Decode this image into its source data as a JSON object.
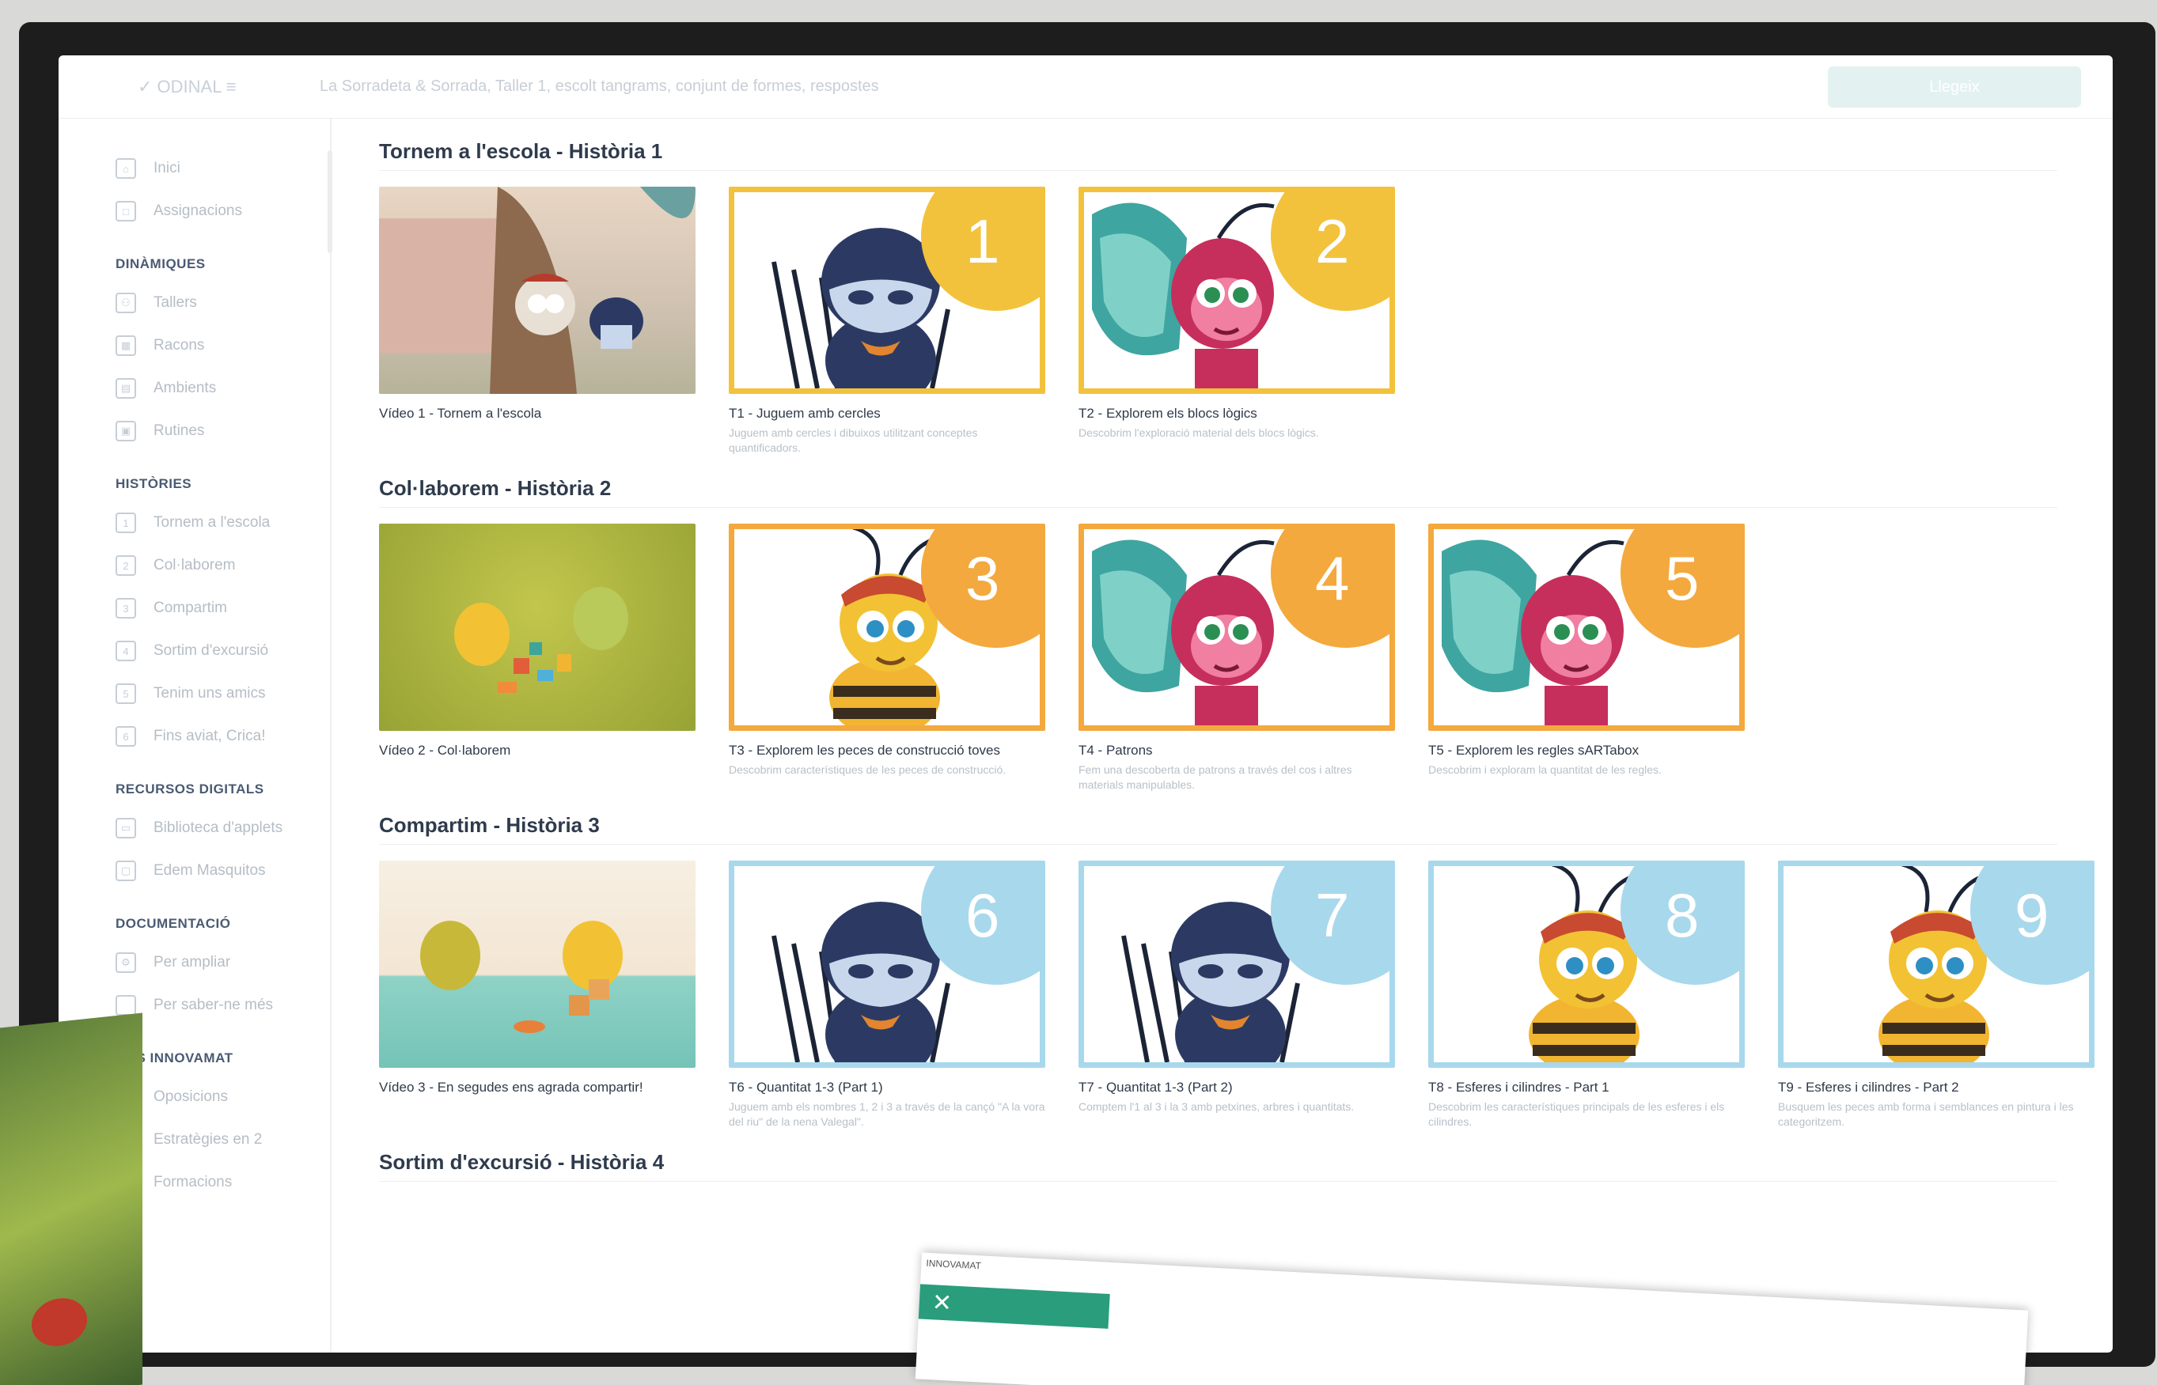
{
  "topbar": {
    "logo": "✓ ODINAL ≡",
    "title": "La Sorradeta & Sorrada, Taller 1, escolt tangrams, conjunt de formes, respostes",
    "button": "Llegeix"
  },
  "sidebar": {
    "top_items": [
      {
        "icon": "home-icon",
        "glyph": "⌂",
        "label": "Inici"
      },
      {
        "icon": "book-icon",
        "glyph": "□",
        "label": "Assignacions"
      }
    ],
    "sections": [
      {
        "title": "DINÀMIQUES",
        "items": [
          {
            "icon": "people-icon",
            "glyph": "⚇",
            "label": "Tallers"
          },
          {
            "icon": "grid-icon",
            "glyph": "▦",
            "label": "Racons"
          },
          {
            "icon": "layout-icon",
            "glyph": "▤",
            "label": "Ambients"
          },
          {
            "icon": "calendar-icon",
            "glyph": "▣",
            "label": "Rutines"
          }
        ]
      },
      {
        "title": "HISTÒRIES",
        "items": [
          {
            "icon": "story-1-icon",
            "glyph": "1",
            "label": "Tornem a l'escola"
          },
          {
            "icon": "story-2-icon",
            "glyph": "2",
            "label": "Col·laborem"
          },
          {
            "icon": "story-3-icon",
            "glyph": "3",
            "label": "Compartim"
          },
          {
            "icon": "story-4-icon",
            "glyph": "4",
            "label": "Sortim d'excursió"
          },
          {
            "icon": "story-5-icon",
            "glyph": "5",
            "label": "Tenim uns amics"
          },
          {
            "icon": "story-6-icon",
            "glyph": "6",
            "label": "Fins aviat, Crica!"
          }
        ]
      },
      {
        "title": "RECURSOS DIGITALS",
        "items": [
          {
            "icon": "library-icon",
            "glyph": "▭",
            "label": "Biblioteca d'applets"
          },
          {
            "icon": "monitor-icon",
            "glyph": "▢",
            "label": "Edem Masquitos"
          }
        ]
      },
      {
        "title": "DOCUMENTACIÓ",
        "items": [
          {
            "icon": "settings-icon",
            "glyph": "⚙",
            "label": "Per ampliar"
          },
          {
            "icon": "doc-icon",
            "glyph": "",
            "label": "Per saber-ne més"
          }
        ]
      },
      {
        "title": "MES INNOVAMAT",
        "items": [
          {
            "icon": "tag-icon",
            "glyph": "◇",
            "label": "Oposicions"
          },
          {
            "icon": "strategy-icon",
            "glyph": "○",
            "label": "Estratègies en 2"
          },
          {
            "icon": "training-icon",
            "glyph": "□",
            "label": "Formacions"
          }
        ]
      }
    ]
  },
  "sections": [
    {
      "title": "Tornem a l'escola - Història 1",
      "cards": [
        {
          "type": "video",
          "title": "Vídeo 1 - Tornem a l'escola",
          "desc": "",
          "scene": "school"
        },
        {
          "type": "task",
          "number": "1",
          "color": "#f3c23d",
          "character": "spider",
          "title": "T1 - Juguem amb cercles",
          "desc": "Juguem amb cercles i dibuixos utilitzant conceptes quantificadors."
        },
        {
          "type": "task",
          "number": "2",
          "color": "#f3c23d",
          "character": "butterfly",
          "title": "T2 - Explorem els blocs lògics",
          "desc": "Descobrim l'exploració material dels blocs lògics."
        }
      ]
    },
    {
      "title": "Col·laborem - Història 2",
      "cards": [
        {
          "type": "video",
          "title": "Vídeo 2 - Col·laborem",
          "desc": "",
          "scene": "green"
        },
        {
          "type": "task",
          "number": "3",
          "color": "#f3a93e",
          "character": "bee",
          "title": "T3 - Explorem les peces de construcció toves",
          "desc": "Descobrim característiques de les peces de construcció."
        },
        {
          "type": "task",
          "number": "4",
          "color": "#f3a93e",
          "character": "butterfly",
          "title": "T4 - Patrons",
          "desc": "Fem una descoberta de patrons a través del cos i altres materials manipulables."
        },
        {
          "type": "task",
          "number": "5",
          "color": "#f3a93e",
          "character": "butterfly",
          "title": "T5 - Explorem les regles sARTabox",
          "desc": "Descobrim i exploram la quantitat de les regles."
        }
      ]
    },
    {
      "title": "Compartim - Història 3",
      "cards": [
        {
          "type": "video",
          "title": "Vídeo 3 - En segudes ens agrada compartir!",
          "desc": "",
          "scene": "teal"
        },
        {
          "type": "task",
          "number": "6",
          "color": "#a8d8ec",
          "character": "spider",
          "title": "T6 - Quantitat 1-3 (Part 1)",
          "desc": "Juguem amb els nombres 1, 2 i 3 a través de la cançó \"A la vora del riu\" de la nena Valegal\"."
        },
        {
          "type": "task",
          "number": "7",
          "color": "#a8d8ec",
          "character": "spider",
          "title": "T7 - Quantitat 1-3 (Part 2)",
          "desc": "Comptem l'1 al 3 i la 3 amb petxines, arbres i quantitats."
        },
        {
          "type": "task",
          "number": "8",
          "color": "#a8d8ec",
          "character": "bee",
          "title": "T8 - Esferes i cilindres - Part 1",
          "desc": "Descobrim les característiques principals de les esferes i els cilindres."
        },
        {
          "type": "task",
          "number": "9",
          "color": "#a8d8ec",
          "character": "bee",
          "title": "T9 - Esferes i cilindres - Part 2",
          "desc": "Busquem les peces amb forma i semblances en pintura i les categoritzem."
        }
      ]
    },
    {
      "title": "Sortim d'excursió - Història 4",
      "cards": []
    }
  ],
  "overlay": {
    "label": "INNOVAMAT",
    "close": "✕"
  }
}
